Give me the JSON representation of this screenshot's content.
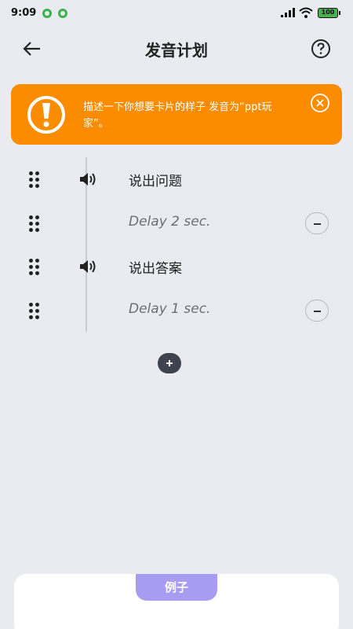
{
  "status_bar": {
    "time": "9:09",
    "battery": "100"
  },
  "header": {
    "title": "发音计划",
    "back_icon": "arrow-left-icon",
    "help_icon": "question-circle-icon"
  },
  "banner": {
    "text": "描述一下你想要卡片的样子 发音为“ppt玩家”。",
    "color": "#fb8c00",
    "icon": "exclamation-circle-icon",
    "close_icon": "close-circle-icon"
  },
  "steps": [
    {
      "type": "speech",
      "label": "说出问题",
      "icon": "speaker-icon"
    },
    {
      "type": "delay",
      "label": "Delay 2 sec."
    },
    {
      "type": "speech",
      "label": "说出答案",
      "icon": "speaker-icon"
    },
    {
      "type": "delay",
      "label": "Delay 1 sec."
    }
  ],
  "add_icon": "plus-icon",
  "example": {
    "tab_label": "例子",
    "tab_color": "#a79cf1"
  }
}
